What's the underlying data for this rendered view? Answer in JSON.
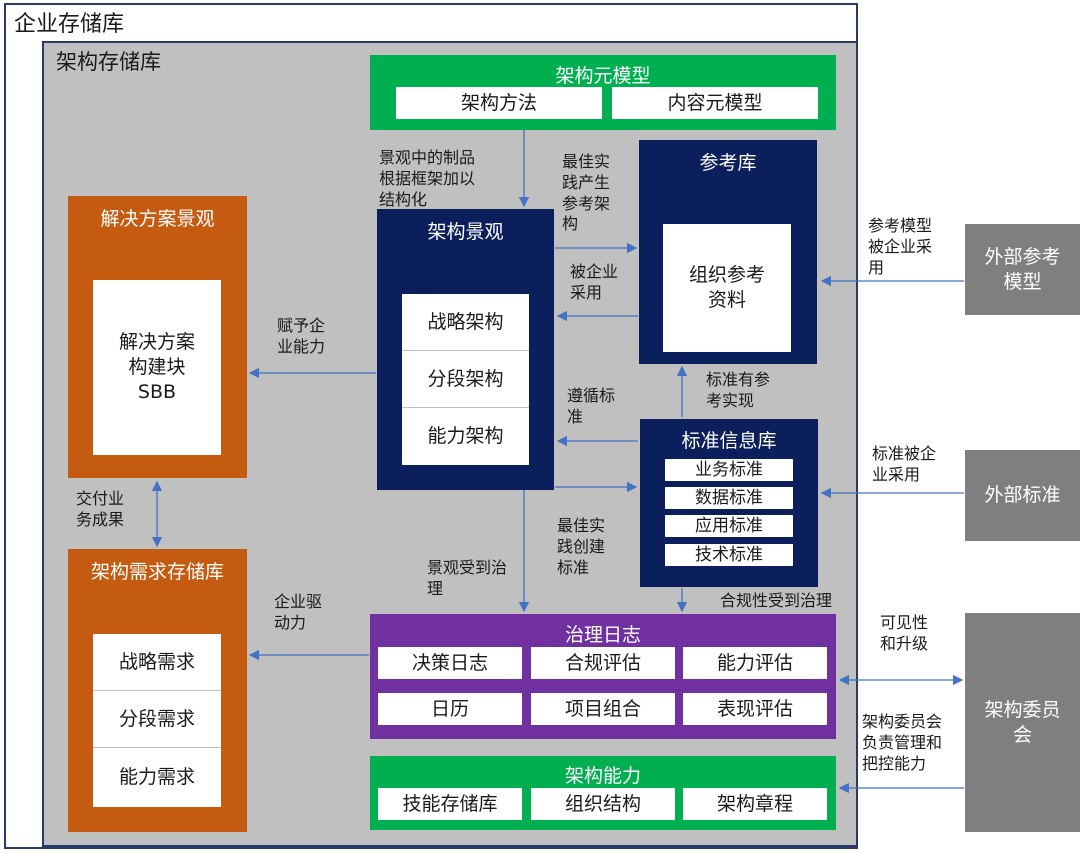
{
  "enterprise_repository": "企业存储库",
  "architecture_repository": "架构存储库",
  "meta_model": {
    "title": "架构元模型",
    "items": [
      "架构方法",
      "内容元模型"
    ]
  },
  "reference_library": {
    "title": "参考库",
    "content": "组织参考\n资料"
  },
  "landscape": {
    "title": "架构景观",
    "items": [
      "战略架构",
      "分段架构",
      "能力架构"
    ]
  },
  "solutions": {
    "title": "解决方案景观",
    "content": "解决方案\n构建块\nSBB"
  },
  "requirements": {
    "title": "架构需求存储库",
    "items": [
      "战略需求",
      "分段需求",
      "能力需求"
    ]
  },
  "standards": {
    "title": "标准信息库",
    "items": [
      "业务标准",
      "数据标准",
      "应用标准",
      "技术标准"
    ]
  },
  "governance_log": {
    "title": "治理日志",
    "items": [
      "决策日志",
      "合规评估",
      "能力评估",
      "日历",
      "项目组合",
      "表现评估"
    ]
  },
  "capability": {
    "title": "架构能力",
    "items": [
      "技能存储库",
      "组织结构",
      "架构章程"
    ]
  },
  "external": {
    "ref_models": "外部参考\n模型",
    "standards": "外部标准",
    "board": "架构委员\n会"
  },
  "labels": {
    "landscape_structured": "景观中的制品\n根据框架加以\n结构化",
    "best_practice_ref": "最佳实\n践产生\n参考架\n构",
    "adopted": "被企业\n采用",
    "empower": "赋予企\n业能力",
    "follow_std": "遵循标\n准",
    "std_ref": "标准有参\n考实现",
    "deliver": "交付业\n务成果",
    "best_practice_std": "最佳实\n践创建\n标准",
    "landscape_gov": "景观受到治\n理",
    "compliance_gov": "合规性受到治理",
    "drive": "企业驱\n动力",
    "ref_adopted": "参考模型\n被企业采\n用",
    "std_adopted": "标准被企\n业采用",
    "visibility": "可见性\n和升级",
    "board_resp": "架构委员会\n负责管理和\n把控能力"
  },
  "colors": {
    "green": "#00b050",
    "navy": "#0b1f5c",
    "orange": "#c55a11",
    "purple": "#7030a0",
    "gray": "#7f7f7f",
    "arrow": "#4472c4"
  }
}
